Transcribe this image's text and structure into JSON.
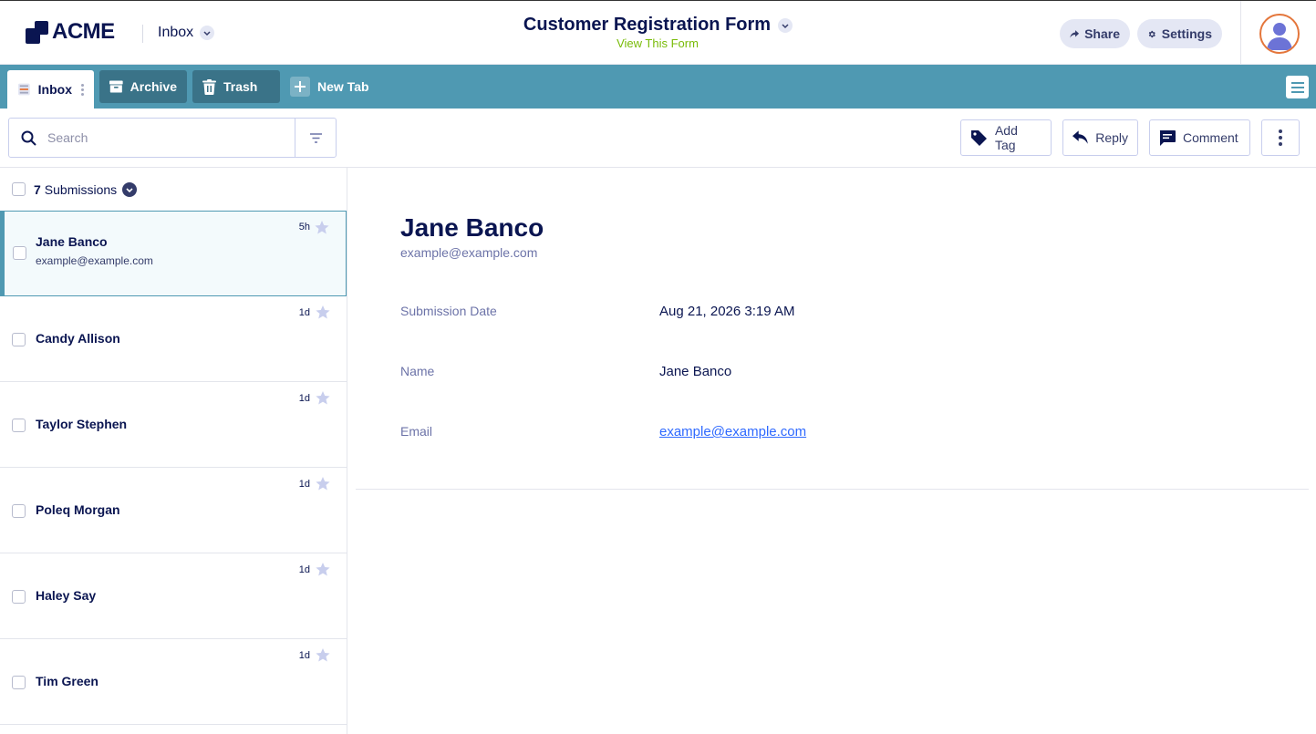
{
  "header": {
    "brand": "ACME",
    "inbox_label": "Inbox",
    "form_title": "Customer Registration Form",
    "view_form": "View This Form",
    "share_label": "Share",
    "settings_label": "Settings"
  },
  "tabs": {
    "inbox": "Inbox",
    "archive": "Archive",
    "trash": "Trash",
    "new_tab": "New Tab"
  },
  "toolbar": {
    "search_placeholder": "Search",
    "add_tag": "Add Tag",
    "reply": "Reply",
    "comment": "Comment"
  },
  "list": {
    "count": "7",
    "count_label": "Submissions",
    "items": [
      {
        "name": "Jane Banco",
        "email": "example@example.com",
        "time": "5h",
        "selected": true
      },
      {
        "name": "Candy Allison",
        "email": "",
        "time": "1d"
      },
      {
        "name": "Taylor Stephen",
        "email": "",
        "time": "1d"
      },
      {
        "name": "Poleq Morgan",
        "email": "",
        "time": "1d"
      },
      {
        "name": "Haley Say",
        "email": "",
        "time": "1d"
      },
      {
        "name": "Tim Green",
        "email": "",
        "time": "1d"
      }
    ]
  },
  "detail": {
    "name": "Jane Banco",
    "email": "example@example.com",
    "fields": [
      {
        "label": "Submission Date",
        "value": "Aug 21, 2026 3:19 AM"
      },
      {
        "label": "Name",
        "value": "Jane Banco"
      },
      {
        "label": "Email",
        "value": "example@example.com"
      }
    ]
  },
  "colors": {
    "navy": "#0a1551",
    "tabbar": "#4f99b2",
    "tab_dark": "#3a7388",
    "accent_green": "#78bb07",
    "link": "#2e69ff",
    "avatar_ring": "#e4763b"
  }
}
